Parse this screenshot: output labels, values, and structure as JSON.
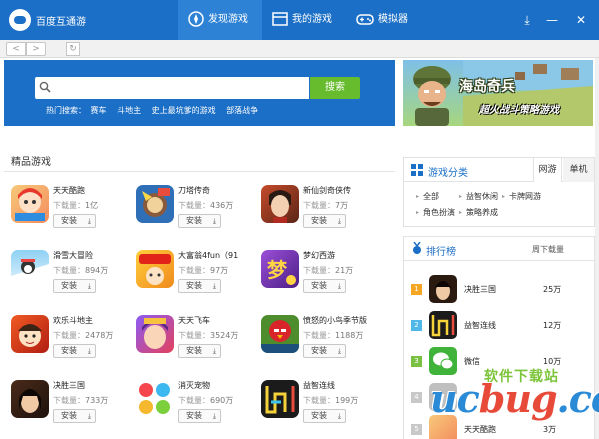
{
  "app": {
    "name": "百度互通游"
  },
  "tabs": [
    {
      "label": "发现游戏",
      "icon": "compass-icon"
    },
    {
      "label": "我的游戏",
      "icon": "window-icon"
    },
    {
      "label": "模拟器",
      "icon": "gamepad-icon"
    }
  ],
  "window_controls": {
    "download": "⤓",
    "minimize": "—",
    "close": "✕"
  },
  "nav": {
    "back": "<",
    "forward": ">",
    "refresh": "↻"
  },
  "search": {
    "placeholder": "",
    "value": "",
    "button": "搜索",
    "hot_label": "热门搜索：",
    "hot": [
      "赛车",
      "斗地主",
      "史上最坑爹的游戏",
      "部落战争"
    ]
  },
  "ad": {
    "title": "海岛奇兵",
    "subtitle": "超火战斗策略游戏"
  },
  "section": {
    "title": "精品游戏"
  },
  "install_label": "安装",
  "downloads_label": "下载量：",
  "games": [
    {
      "name": "天天酷跑",
      "downloads": "1亿"
    },
    {
      "name": "刀塔传奇",
      "downloads": "436万"
    },
    {
      "name": "新仙剑奇侠传",
      "downloads": "7万"
    },
    {
      "name": "滑雪大冒险",
      "downloads": "894万"
    },
    {
      "name": "大富翁4fun（91",
      "downloads": "97万"
    },
    {
      "name": "梦幻西游",
      "downloads": "21万"
    },
    {
      "name": "欢乐斗地主",
      "downloads": "2478万"
    },
    {
      "name": "天天飞车",
      "downloads": "3524万"
    },
    {
      "name": "愤怒的小鸟季节版",
      "downloads": "1188万"
    },
    {
      "name": "决胜三国",
      "downloads": "733万"
    },
    {
      "name": "消灭宠物",
      "downloads": "690万"
    },
    {
      "name": "益智连线",
      "downloads": "199万"
    }
  ],
  "categories": {
    "title": "游戏分类",
    "tabs": [
      "网游",
      "单机"
    ],
    "links": [
      "全部",
      "益智休闲",
      "卡牌网游",
      "角色扮演",
      "策略养成"
    ]
  },
  "ranking": {
    "title": "排行榜",
    "column": "周下载量",
    "rows": [
      {
        "rank": "1",
        "name": "决胜三国",
        "downloads": "25万"
      },
      {
        "rank": "2",
        "name": "益智连线",
        "downloads": "12万"
      },
      {
        "rank": "3",
        "name": "微信",
        "downloads": "10万"
      },
      {
        "rank": "4",
        "name": "",
        "downloads": ""
      },
      {
        "rank": "5",
        "name": "天天酷跑",
        "downloads": "3万"
      }
    ]
  },
  "watermark": {
    "top": "软件下载站",
    "main_a": "uc",
    "main_b": "bug",
    "main_c": ".cc"
  },
  "colors": {
    "brand_blue": "#1c6fc6",
    "search_green": "#66bc2d",
    "rank1": "#f5a623",
    "rank2": "#4fb8e8",
    "rank3": "#7ac143"
  }
}
